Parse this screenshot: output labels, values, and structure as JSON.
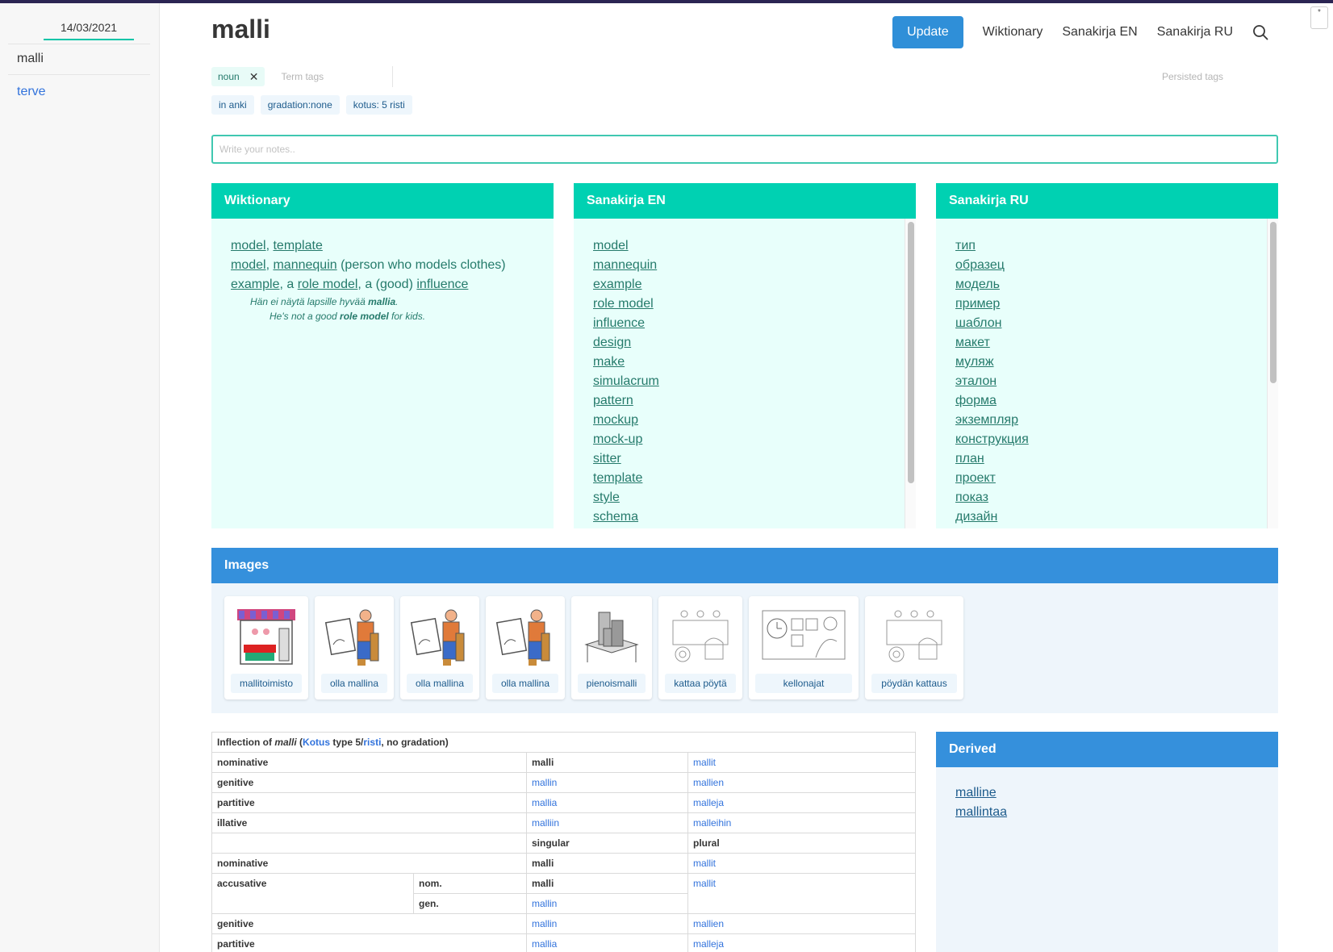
{
  "sidebar": {
    "date": "14/03/2021",
    "items": [
      {
        "label": "malli"
      },
      {
        "label": "terve"
      }
    ]
  },
  "header": {
    "title": "malli",
    "update_label": "Update",
    "nav": [
      "Wiktionary",
      "Sanakirja EN",
      "Sanakirja RU"
    ],
    "corner_label": "*"
  },
  "tags": {
    "term_tags": [
      "noun"
    ],
    "term_placeholder": "Term tags",
    "persisted_placeholder": "Persisted tags",
    "info_tags": [
      "in anki",
      "gradation:none",
      "kotus: 5 risti"
    ]
  },
  "notes": {
    "placeholder": "Write your notes.."
  },
  "wiktionary": {
    "title": "Wiktionary",
    "line1": {
      "a": "model",
      "sep": ", ",
      "b": "template"
    },
    "line2": {
      "a": "model",
      "sep": ", ",
      "b": "mannequin",
      "rest": " (person who models clothes)"
    },
    "line3": {
      "a": "example",
      "t1": ", a ",
      "b": "role model",
      "t2": ", a (good) ",
      "c": "influence"
    },
    "example_fi": {
      "pre": "Hän ei näytä lapsille hyvää ",
      "bold": "mallia",
      "post": "."
    },
    "example_en": {
      "pre": "He's not a good ",
      "bold": "role model",
      "post": " for kids."
    }
  },
  "sanakirja_en": {
    "title": "Sanakirja EN",
    "words": [
      "model",
      "mannequin",
      "example",
      "role model",
      "influence",
      "design",
      "make",
      "simulacrum",
      "pattern",
      "mockup",
      "mock-up",
      "sitter",
      "template",
      "style",
      "schema"
    ]
  },
  "sanakirja_ru": {
    "title": "Sanakirja RU",
    "words": [
      "тип",
      "образец",
      "модель",
      "пример",
      "шаблон",
      "макет",
      "муляж",
      "эталон",
      "форма",
      "экземпляр",
      "конструкция",
      "план",
      "проект",
      "показ",
      "дизайн"
    ]
  },
  "images": {
    "title": "Images",
    "items": [
      {
        "caption": "mallitoimisto",
        "icon": "model-agency-icon"
      },
      {
        "caption": "olla mallina",
        "icon": "posing-model-icon"
      },
      {
        "caption": "olla mallina",
        "icon": "posing-model-icon"
      },
      {
        "caption": "olla mallina",
        "icon": "posing-model-icon"
      },
      {
        "caption": "pienoismalli",
        "icon": "scale-model-icon"
      },
      {
        "caption": "kattaa pöytä",
        "icon": "set-table-icon"
      },
      {
        "caption": "kellonajat",
        "icon": "clock-times-icon"
      },
      {
        "caption": "pöydän kattaus",
        "icon": "set-table-icon"
      }
    ]
  },
  "inflection": {
    "caption": {
      "pre": "Inflection of ",
      "word": "malli",
      "open": " (",
      "kotus": "Kotus",
      "mid": " type 5/",
      "risti": "risti",
      "post": ", no gradation)"
    },
    "top_rows": [
      {
        "case": "nominative",
        "sg": "malli",
        "pl": "mallit"
      },
      {
        "case": "genitive",
        "sg": "mallin",
        "pl": "mallien"
      },
      {
        "case": "partitive",
        "sg": "mallia",
        "pl": "malleja"
      },
      {
        "case": "illative",
        "sg": "malliin",
        "pl": "malleihin"
      }
    ],
    "header": {
      "sg": "singular",
      "pl": "plural"
    },
    "nominative": {
      "case": "nominative",
      "sg": "malli",
      "pl": "mallit"
    },
    "accusative": {
      "case": "accusative",
      "nom_label": "nom.",
      "nom_sg": "malli",
      "gen_label": "gen.",
      "gen_sg": "mallin",
      "pl": "mallit"
    },
    "bottom_rows": [
      {
        "case": "genitive",
        "sg": "mallin",
        "pl": "mallien"
      },
      {
        "case": "partitive",
        "sg": "mallia",
        "pl": "malleja"
      }
    ]
  },
  "derived": {
    "title": "Derived",
    "words": [
      "malline",
      "mallintaa"
    ]
  },
  "colors": {
    "accent_teal": "#00d1b2",
    "accent_blue": "#3590dc",
    "link_blue": "#3273dc",
    "topbar": "#2b2553"
  }
}
